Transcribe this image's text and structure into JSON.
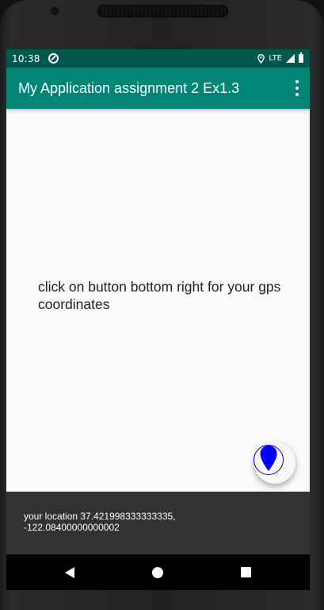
{
  "status_bar": {
    "time": "10:38",
    "network": "LTE"
  },
  "app_bar": {
    "title": "My Application assignment 2 Ex1.3",
    "menu_icon": "overflow-menu-icon"
  },
  "main": {
    "message": "click on button bottom right for your gps coordinates"
  },
  "fab": {
    "icon": "location-pin-icon",
    "color": "#0000ff"
  },
  "snackbar": {
    "text": "your location 37.421998333333335, -122.08400000000002"
  },
  "nav": {
    "back": "back-icon",
    "home": "home-icon",
    "recents": "recents-icon"
  },
  "colors": {
    "status_bar": "#00574b",
    "app_bar": "#008577",
    "snackbar": "#323232",
    "background": "#fafafa"
  }
}
